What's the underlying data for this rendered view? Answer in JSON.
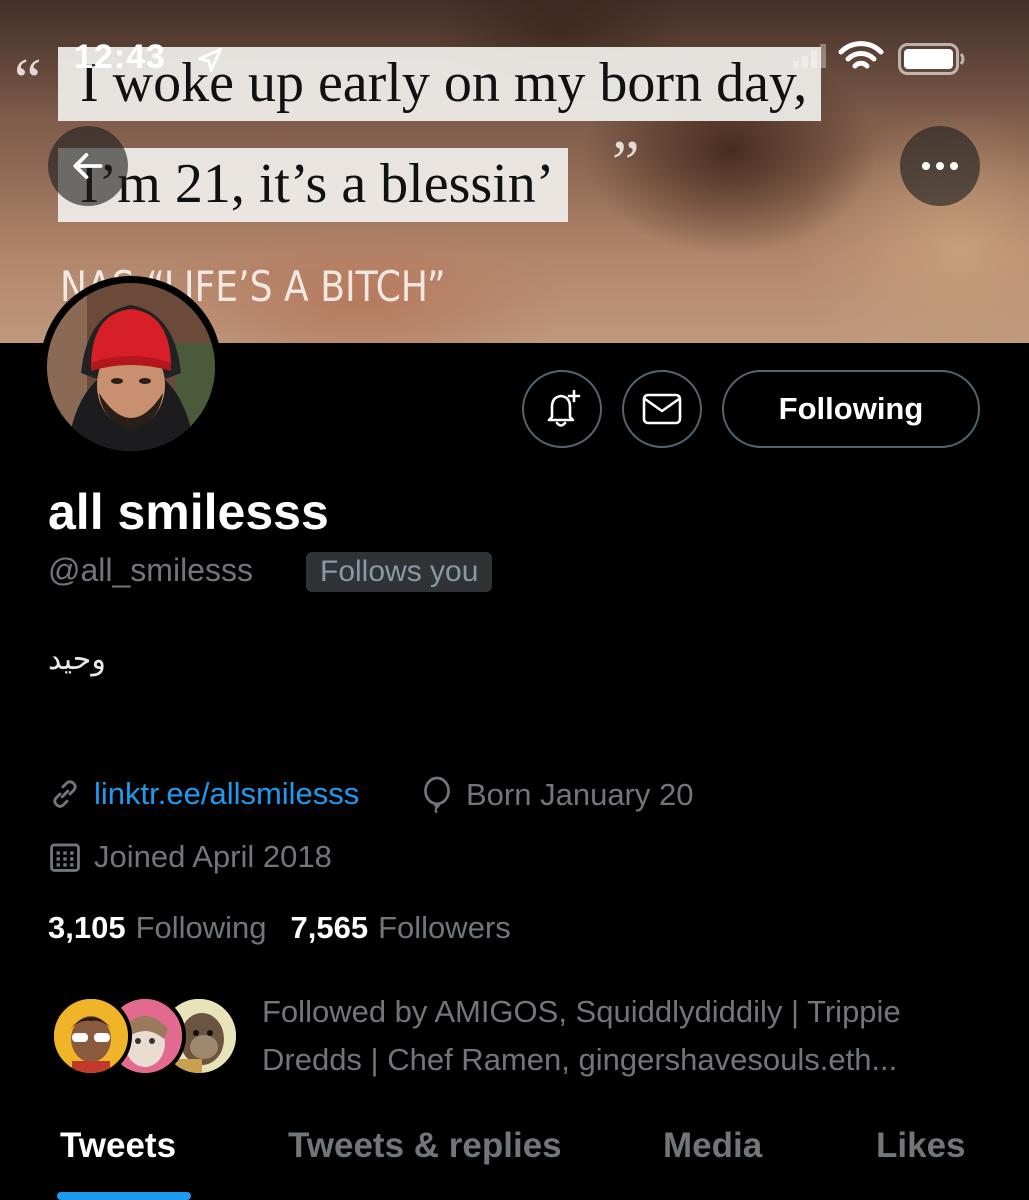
{
  "status_bar": {
    "time": "12:43"
  },
  "banner": {
    "quote_open": "“",
    "quote_close": "”",
    "line1": "I woke up early on my born day,",
    "line2": "I’m 21, it’s a blessin’",
    "attribution": "NAS “LIFE’S A BITCH”"
  },
  "actions": {
    "follow_label": "Following"
  },
  "profile": {
    "display_name": "all smilesss",
    "handle": "@all_smilesss",
    "follows_you": "Follows you",
    "bio": "وحيد",
    "link": "linktr.ee/allsmilesss",
    "birthday": "Born January 20",
    "joined": "Joined April 2018"
  },
  "stats": {
    "following_count": "3,105",
    "following_label": "Following",
    "followers_count": "7,565",
    "followers_label": "Followers"
  },
  "followed_by": {
    "text": "Followed by AMIGOS, Squiddlydiddily | Trippie Dredds | Chef Ramen, gingershavesouls.eth..."
  },
  "tabs": [
    {
      "label": "Tweets",
      "active": true
    },
    {
      "label": "Tweets & replies",
      "active": false
    },
    {
      "label": "Media",
      "active": false
    },
    {
      "label": "Likes",
      "active": false
    }
  ],
  "colors": {
    "accent": "#1d9bf0",
    "background": "#000000",
    "secondary_text": "#71767b",
    "border": "#536471"
  },
  "icons": [
    "back-arrow-icon",
    "more-icon",
    "bell-plus-icon",
    "envelope-icon",
    "link-icon",
    "balloon-icon",
    "calendar-icon",
    "location-arrow-icon",
    "signal-icon",
    "wifi-icon",
    "battery-icon"
  ]
}
